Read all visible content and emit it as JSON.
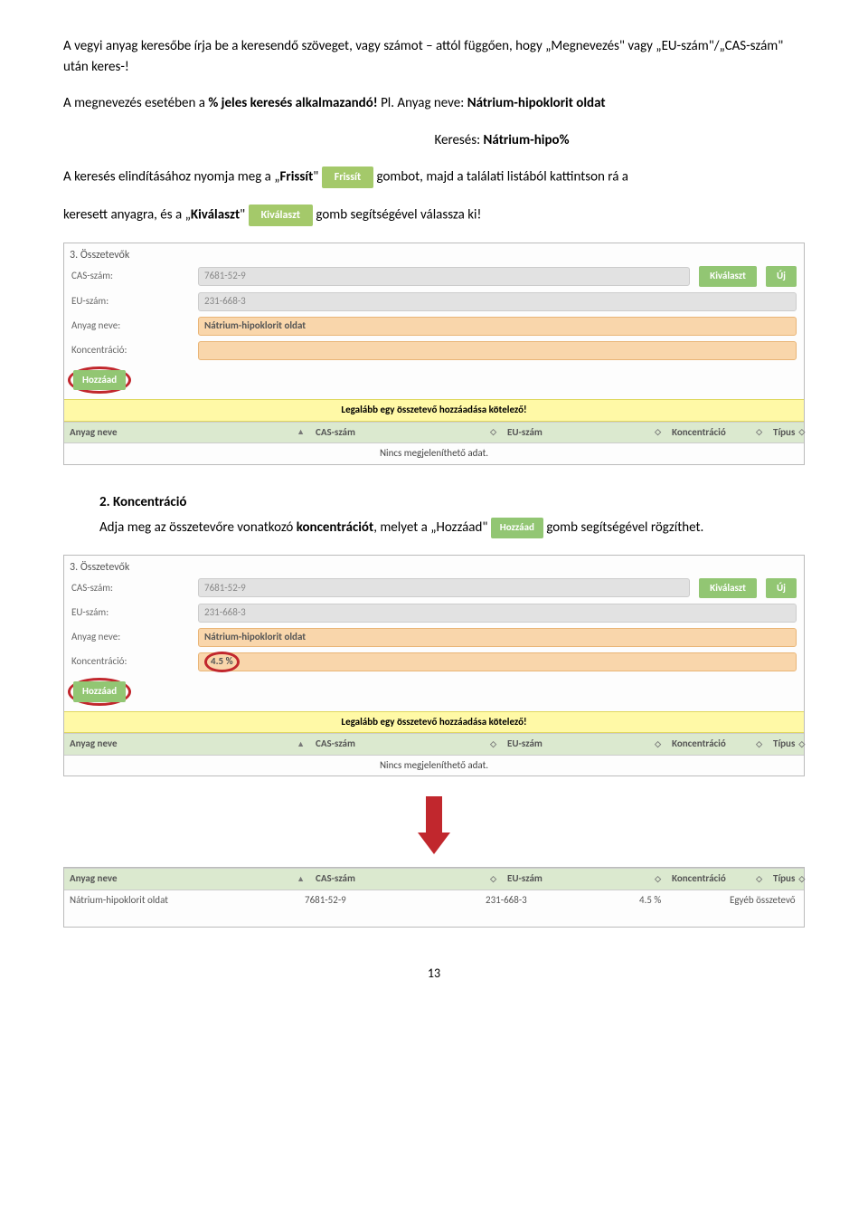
{
  "intro": {
    "p1": "A vegyi anyag keresőbe írja be a keresendő szöveget, vagy számot – attól függően, hogy „Megnevezés\" vagy „EU-szám\"/„CAS-szám\" után keres-!",
    "p2_prefix": "A megnevezés esetében a ",
    "p2_bold": "% jeles keresés alkalmazandó!",
    "p2_suffix": " Pl. Anyag neve: ",
    "p2_example": "Nátrium-hipoklorit oldat",
    "p3_prefix": "Keresés: ",
    "p3_bold": "Nátrium-hipo%",
    "p4_a": "A keresés elindításához nyomja meg a „",
    "p4_b": "Frissít",
    "p4_c": "\" ",
    "p4_btn": "Frissít",
    "p4_d": " gombot, majd a találati listából kattintson rá a",
    "p5_a": "keresett anyagra, és a „",
    "p5_b": "Kiválaszt",
    "p5_c": "\" ",
    "p5_btn": "Kiválaszt",
    "p5_d": " gomb segítségével válassza ki!"
  },
  "panel1": {
    "title": "3. Összetevők",
    "cas_label": "CAS-szám:",
    "cas_value": "7681-52-9",
    "eu_label": "EU-szám:",
    "eu_value": "231-668-3",
    "name_label": "Anyag neve:",
    "name_value": "Nátrium-hipoklorit oldat",
    "konc_label": "Koncentráció:",
    "konc_value": "",
    "kivalaszt": "Kiválaszt",
    "uj": "Új",
    "hozzaad": "Hozzáad",
    "warning": "Legalább egy összetevő hozzáadása kötelező!",
    "th_anyag": "Anyag neve",
    "th_cas": "CAS-szám",
    "th_eu": "EU-szám",
    "th_konc": "Koncentráció",
    "th_tipus": "Típus",
    "empty": "Nincs megjeleníthető adat."
  },
  "section2": {
    "heading": "2.  Koncentráció",
    "text_a": "Adja meg az összetevőre vonatkozó ",
    "text_bold": "koncentrációt",
    "text_b": ", melyet a „Hozzáad\" ",
    "btn": "Hozzáad",
    "text_c": " gomb segítségével rögzíthet."
  },
  "panel2": {
    "title": "3. Összetevők",
    "cas_label": "CAS-szám:",
    "cas_value": "7681-52-9",
    "eu_label": "EU-szám:",
    "eu_value": "231-668-3",
    "name_label": "Anyag neve:",
    "name_value": "Nátrium-hipoklorit oldat",
    "konc_label": "Koncentráció:",
    "konc_value": "4.5 %",
    "kivalaszt": "Kiválaszt",
    "uj": "Új",
    "hozzaad": "Hozzáad",
    "warning": "Legalább egy összetevő hozzáadása kötelező!",
    "th_anyag": "Anyag neve",
    "th_cas": "CAS-szám",
    "th_eu": "EU-szám",
    "th_konc": "Koncentráció",
    "th_tipus": "Típus",
    "empty": "Nincs megjeleníthető adat."
  },
  "panel3": {
    "th_anyag": "Anyag neve",
    "th_cas": "CAS-szám",
    "th_eu": "EU-szám",
    "th_konc": "Koncentráció",
    "th_tipus": "Típus",
    "row_anyag": "Nátrium-hipoklorit oldat",
    "row_cas": "7681-52-9",
    "row_eu": "231-668-3",
    "row_konc": "4.5 %",
    "row_tipus": "Egyéb összetevő"
  },
  "page": "13"
}
